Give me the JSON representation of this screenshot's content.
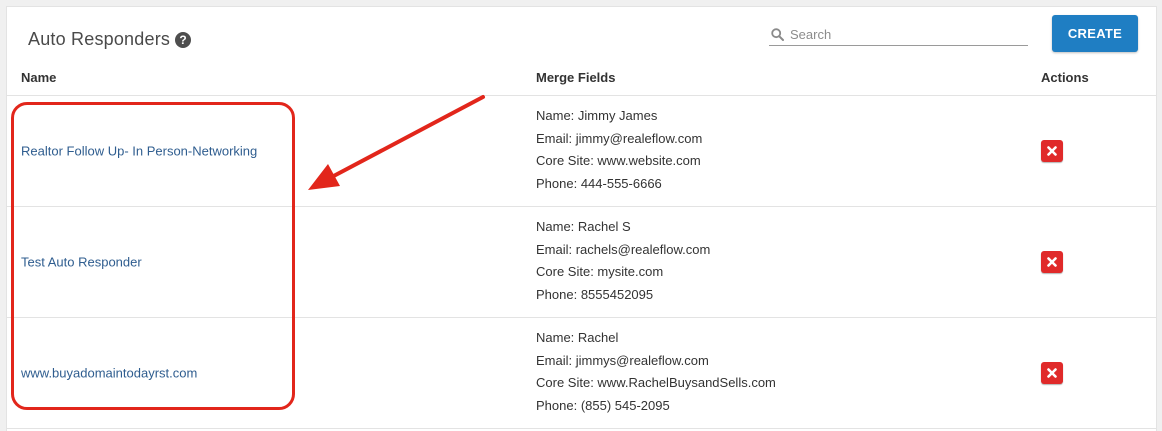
{
  "header": {
    "title": "Auto Responders",
    "help_icon": "?",
    "search_placeholder": "Search",
    "create_label": "CREATE"
  },
  "table": {
    "columns": {
      "name": "Name",
      "merge": "Merge Fields",
      "actions": "Actions"
    },
    "rows": [
      {
        "name": "Realtor Follow Up- In Person-Networking",
        "merge": [
          "Name: Jimmy James",
          "Email: jimmy@realeflow.com",
          "Core Site: www.website.com",
          "Phone: 444-555-6666"
        ]
      },
      {
        "name": "Test Auto Responder",
        "merge": [
          "Name: Rachel S",
          "Email: rachels@realeflow.com",
          "Core Site: mysite.com",
          "Phone: 8555452095"
        ]
      },
      {
        "name": "www.buyadomaintodayrst.com",
        "merge": [
          "Name: Rachel",
          "Email: jimmys@realeflow.com",
          "Core Site: www.RachelBuysandSells.com",
          "Phone: (855) 545-2095"
        ]
      }
    ]
  },
  "icons": {
    "search": "search-icon",
    "delete": "delete-x-icon",
    "help": "question-circle-icon"
  },
  "colors": {
    "accent": "#1f7ec3",
    "link": "#2f5d8f",
    "delete": "#e02a2a",
    "annotation": "#e2261b"
  }
}
